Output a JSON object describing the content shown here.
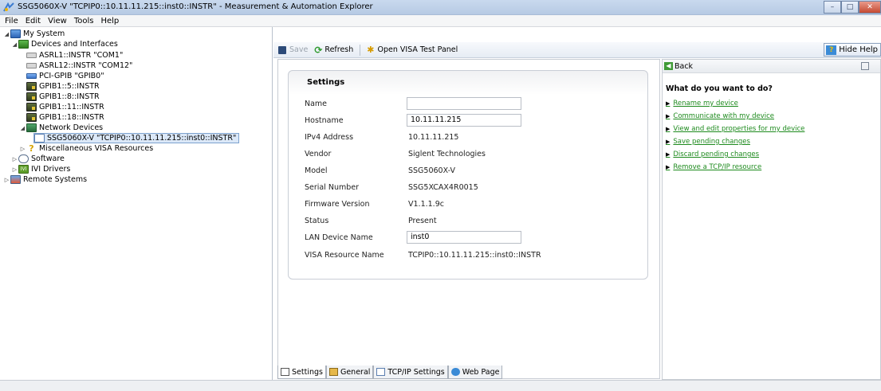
{
  "window": {
    "title": "SSG5060X-V \"TCPIP0::10.11.11.215::inst0::INSTR\" - Measurement & Automation Explorer",
    "controls": [
      "minimize",
      "maximize",
      "close"
    ]
  },
  "menu": {
    "items": [
      "File",
      "Edit",
      "View",
      "Tools",
      "Help"
    ]
  },
  "tree": {
    "my_system": "My System",
    "devices_and_interfaces": "Devices and Interfaces",
    "asrl1": "ASRL1::INSTR \"COM1\"",
    "asrl12": "ASRL12::INSTR \"COM12\"",
    "pci_gpib": "PCI-GPIB \"GPIB0\"",
    "gpib5": "GPIB1::5::INSTR",
    "gpib8": "GPIB1::8::INSTR",
    "gpib11": "GPIB1::11::INSTR",
    "gpib18": "GPIB1::18::INSTR",
    "network_devices": "Network Devices",
    "selected_device": "SSG5060X-V \"TCPIP0::10.11.11.215::inst0::INSTR\"",
    "misc_visa": "Miscellaneous VISA Resources",
    "software": "Software",
    "ivi_drivers": "IVI Drivers",
    "remote_systems": "Remote Systems"
  },
  "toolbar": {
    "save": "Save",
    "refresh": "Refresh",
    "open_visa": "Open VISA Test Panel",
    "hide_help": "Hide Help"
  },
  "settings": {
    "title": "Settings",
    "name_label": "Name",
    "name_value": "",
    "hostname_label": "Hostname",
    "hostname_value": "10.11.11.215",
    "ipv4_label": "IPv4 Address",
    "ipv4_value": "10.11.11.215",
    "vendor_label": "Vendor",
    "vendor_value": "Siglent Technologies",
    "model_label": "Model",
    "model_value": "SSG5060X-V",
    "serial_label": "Serial Number",
    "serial_value": "SSG5XCAX4R0015",
    "firmware_label": "Firmware Version",
    "firmware_value": "V1.1.1.9c",
    "status_label": "Status",
    "status_value": "Present",
    "lan_label": "LAN Device Name",
    "lan_value": "inst0",
    "visa_label": "VISA Resource Name",
    "visa_value": "TCPIP0::10.11.11.215::inst0::INSTR"
  },
  "tabs": [
    "Settings",
    "General",
    "TCP/IP Settings",
    "Web Page"
  ],
  "help": {
    "back": "Back",
    "title": "What do you want to do?",
    "links": [
      "Rename my device",
      "Communicate with my device",
      "View and edit properties for my device",
      "Save pending changes",
      "Discard pending changes",
      "Remove a TCP/IP resource"
    ]
  }
}
